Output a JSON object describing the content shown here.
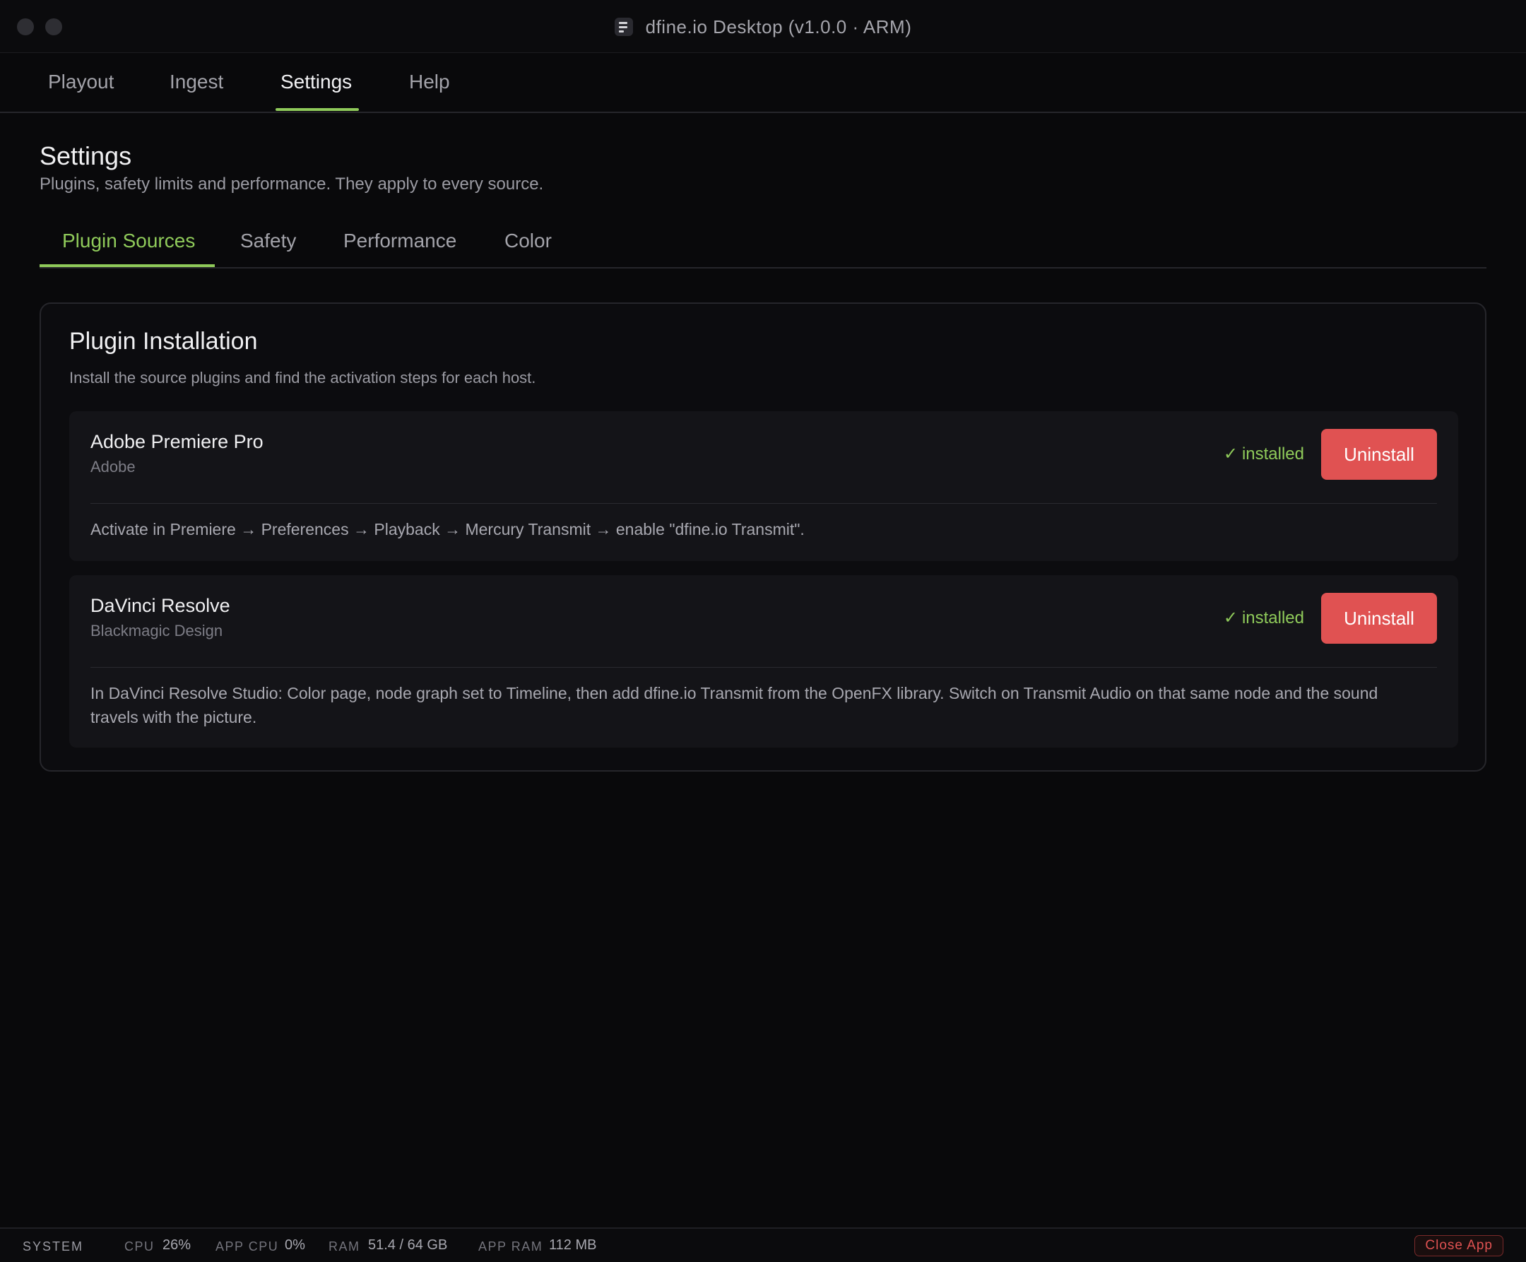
{
  "window": {
    "title": "dfine.io Desktop (v1.0.0 · ARM)",
    "app_icon": "document-lines-icon"
  },
  "main_tabs": [
    {
      "label": "Playout",
      "active": false
    },
    {
      "label": "Ingest",
      "active": false
    },
    {
      "label": "Settings",
      "active": true
    },
    {
      "label": "Help",
      "active": false
    }
  ],
  "header": {
    "title": "Settings",
    "subtitle": "Plugins, safety limits and performance. They apply to every source."
  },
  "sub_tabs": [
    {
      "label": "Plugin Sources",
      "active": true
    },
    {
      "label": "Safety",
      "active": false
    },
    {
      "label": "Performance",
      "active": false
    },
    {
      "label": "Color",
      "active": false
    }
  ],
  "panel": {
    "title": "Plugin Installation",
    "subtitle": "Install the source plugins and find the activation steps for each host.",
    "plugins": [
      {
        "name": "Adobe Premiere Pro",
        "vendor": "Adobe",
        "status_icon": "checkmark-icon",
        "status_check": "✓",
        "status": "installed",
        "action": "Uninstall",
        "instructions": "Activate in Premiere → Preferences → Playback → Mercury Transmit → enable \"dfine.io Transmit\"."
      },
      {
        "name": "DaVinci Resolve",
        "vendor": "Blackmagic Design",
        "status_icon": "checkmark-icon",
        "status_check": "✓",
        "status": "installed",
        "action": "Uninstall",
        "instructions": "In DaVinci Resolve Studio: Color page, node graph set to Timeline, then add dfine.io Transmit from the OpenFX library. Switch on Transmit Audio on that same node and the sound travels with the picture."
      }
    ]
  },
  "statusbar": {
    "system_label": "SYSTEM",
    "cpu_label": "CPU",
    "cpu_value": "26%",
    "app_cpu_label": "APP CPU",
    "app_cpu_value": "0%",
    "ram_label": "RAM",
    "ram_value": "51.4 / 64 GB",
    "app_ram_label": "APP RAM",
    "app_ram_value": "112 MB",
    "close_label": "Close App"
  },
  "colors": {
    "accent": "#8fca5a",
    "danger": "#e05252",
    "background": "#09090b"
  }
}
